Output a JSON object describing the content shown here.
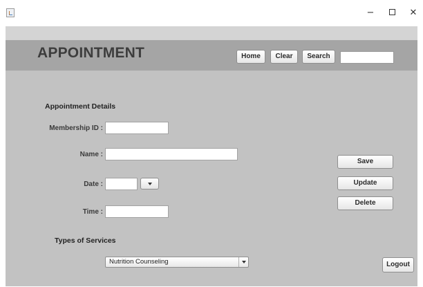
{
  "window": {
    "minimize_glyph": "−",
    "close_glyph": "✕"
  },
  "header": {
    "title": "APPOINTMENT",
    "home_label": "Home",
    "clear_label": "Clear",
    "search_label": "Search",
    "search_value": ""
  },
  "form": {
    "section_details": "Appointment Details",
    "membership_label": "Membership ID :",
    "membership_value": "",
    "name_label": "Name :",
    "name_value": "",
    "date_label": "Date :",
    "date_value": "",
    "time_label": "Time :",
    "time_value": "",
    "section_services": "Types of Services",
    "service_selected": "Nutrition Counseling"
  },
  "actions": {
    "save_label": "Save",
    "update_label": "Update",
    "delete_label": "Delete",
    "logout_label": "Logout"
  },
  "icons": {
    "app": "java-app-icon",
    "minimize": "minimize-icon",
    "maximize": "maximize-icon",
    "close": "close-icon",
    "date_dropdown": "chevron-down-icon",
    "combo_dropdown": "chevron-down-icon"
  }
}
